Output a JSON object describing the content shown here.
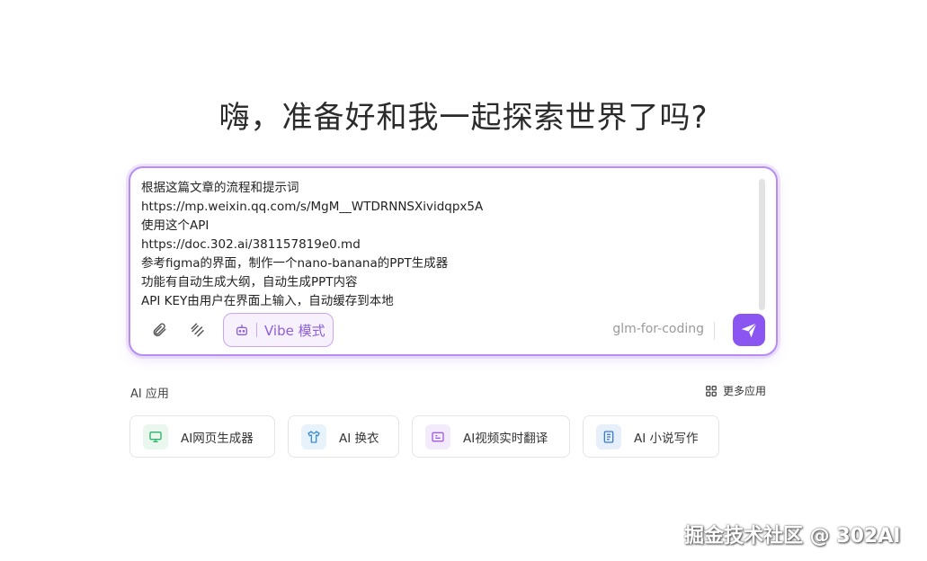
{
  "headline": "嗨，准备好和我一起探索世界了吗?",
  "chat": {
    "text": "根据这篇文章的流程和提示词\nhttps://mp.weixin.qq.com/s/MgM__WTDRNNSXividqpx5A\n使用这个API\nhttps://doc.302.ai/381157819e0.md\n参考figma的界面，制作一个nano-banana的PPT生成器\n功能有自动生成大纲，自动生成PPT内容\nAPI KEY由用户在界面上输入，自动缓存到本地",
    "vibe_label": "Vibe 模式",
    "model": "glm-for-coding"
  },
  "apps": {
    "section_label": "AI 应用",
    "more_label": "更多应用",
    "items": [
      {
        "label": "AI网页生成器",
        "icon": "monitor-icon",
        "color": "#2fb36b",
        "bg": "#eaf7ef"
      },
      {
        "label": "AI 换衣",
        "icon": "shirt-icon",
        "color": "#3a8ed8",
        "bg": "#e8f2fb"
      },
      {
        "label": "AI视频实时翻译",
        "icon": "video-icon",
        "color": "#a05ee0",
        "bg": "#f3ebfc"
      },
      {
        "label": "AI 小说写作",
        "icon": "book-icon",
        "color": "#3a7bd5",
        "bg": "#e7effb"
      }
    ]
  },
  "watermark": "掘金技术社区 @ 302AI",
  "colors": {
    "accent": "#8b55f2",
    "border": "#b88cf0"
  }
}
